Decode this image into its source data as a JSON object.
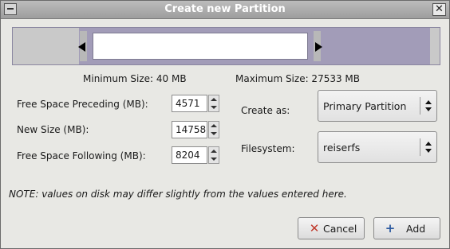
{
  "window": {
    "title": "Create new Partition",
    "close_glyph": "✕"
  },
  "sizes": {
    "minimum": "Minimum Size: 40 MB",
    "maximum": "Maximum Size: 27533 MB"
  },
  "fields": {
    "free_before": {
      "label": "Free Space Preceding (MB):",
      "value": "4571"
    },
    "new_size": {
      "label": "New Size (MB):",
      "value": "14758"
    },
    "free_after": {
      "label": "Free Space Following (MB):",
      "value": "8204"
    }
  },
  "create_as": {
    "label": "Create as:",
    "value": "Primary Partition"
  },
  "filesystem": {
    "label": "Filesystem:",
    "value": "reiserfs"
  },
  "note": "NOTE: values on disk may differ slightly from the values entered here.",
  "buttons": {
    "cancel": {
      "label": "Cancel",
      "icon": "cancel-icon",
      "glyph": "✕"
    },
    "add": {
      "label": "Add",
      "icon": "add-icon",
      "glyph": "+"
    }
  },
  "colors": {
    "partition_bar": "#a29cb8",
    "unallocated": "#c9c9c9"
  },
  "partition_visual": {
    "free_preceding_mb": 4571,
    "new_size_mb": 14758,
    "free_following_mb": 8204
  }
}
